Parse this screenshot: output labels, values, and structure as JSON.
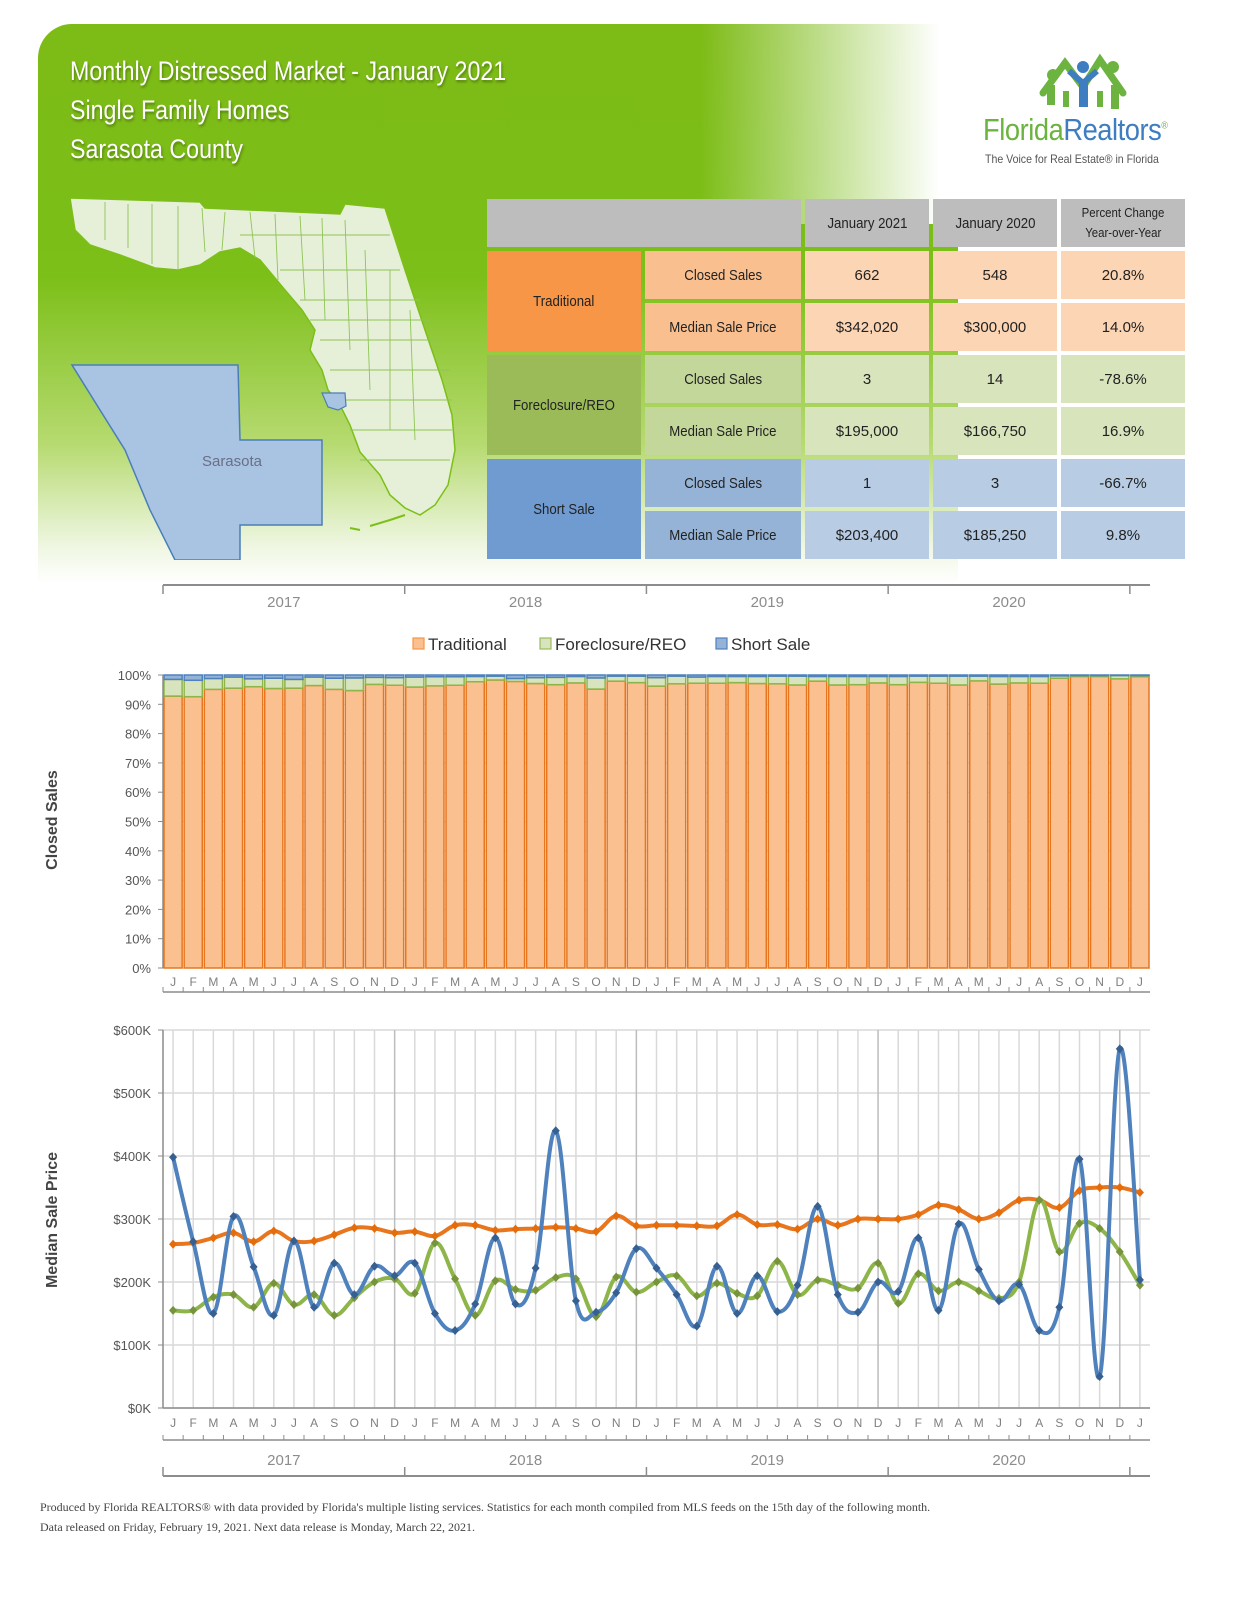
{
  "header": {
    "title_line1": "Monthly Distressed Market - January 2021",
    "title_line2": "Single Family Homes",
    "title_line3": "Sarasota County"
  },
  "logo": {
    "name_part1": "Florida",
    "name_part2": "Realtors",
    "registered": "®",
    "tagline": "The Voice for Real Estate® in Florida"
  },
  "map": {
    "county_label": "Sarasota",
    "colors": {
      "state": "#e6f0d8",
      "county": "#a9c4e2",
      "border_green": "#7cbf18",
      "border_blue": "#4a7eb8"
    }
  },
  "stats_table": {
    "columns": [
      "January 2021",
      "January 2020",
      "Percent Change Year-over-Year"
    ],
    "col3_line1": "Percent Change",
    "col3_line2": "Year-over-Year",
    "groups": [
      {
        "category": "Traditional",
        "rows": [
          {
            "metric": "Closed Sales",
            "current": "662",
            "prior": "548",
            "change": "20.8%"
          },
          {
            "metric": "Median Sale Price",
            "current": "$342,020",
            "prior": "$300,000",
            "change": "14.0%"
          }
        ]
      },
      {
        "category": "Foreclosure/REO",
        "rows": [
          {
            "metric": "Closed Sales",
            "current": "3",
            "prior": "14",
            "change": "-78.6%"
          },
          {
            "metric": "Median Sale Price",
            "current": "$195,000",
            "prior": "$166,750",
            "change": "16.9%"
          }
        ]
      },
      {
        "category": "Short Sale",
        "rows": [
          {
            "metric": "Closed Sales",
            "current": "1",
            "prior": "3",
            "change": "-66.7%"
          },
          {
            "metric": "Median Sale Price",
            "current": "$203,400",
            "prior": "$185,250",
            "change": "9.8%"
          }
        ]
      }
    ]
  },
  "colors": {
    "traditional": "#f79646",
    "traditional_fill": "#fac090",
    "traditional_line": "#e8761f",
    "foreclosure": "#9bbb59",
    "foreclosure_fill": "#d7e4bd",
    "foreclosure_line": "#8db54a",
    "short_sale": "#4f81bd",
    "short_sale_fill": "#95b3d7"
  },
  "chart_data": [
    {
      "type": "bar",
      "stacked": "percent",
      "ylabel": "Closed Sales",
      "ylim": [
        0,
        100
      ],
      "yticks": [
        "0%",
        "10%",
        "20%",
        "30%",
        "40%",
        "50%",
        "60%",
        "70%",
        "80%",
        "90%",
        "100%"
      ],
      "grid": true,
      "legend": {
        "placement": "top-center",
        "entries": [
          "Traditional",
          "Foreclosure/REO",
          "Short Sale"
        ]
      },
      "month_labels": [
        "J",
        "F",
        "M",
        "A",
        "M",
        "J",
        "J",
        "A",
        "S",
        "O",
        "N",
        "D",
        "J",
        "F",
        "M",
        "A",
        "M",
        "J",
        "J",
        "A",
        "S",
        "O",
        "N",
        "D",
        "J",
        "F",
        "M",
        "A",
        "M",
        "J",
        "J",
        "A",
        "S",
        "O",
        "N",
        "D",
        "J",
        "F",
        "M",
        "A",
        "M",
        "J",
        "J",
        "A",
        "S",
        "O",
        "N",
        "D",
        "J"
      ],
      "year_labels": [
        "2017",
        "2018",
        "2019",
        "2020"
      ],
      "series": [
        {
          "name": "Traditional",
          "values": [
            92.8,
            92.6,
            95.1,
            95.5,
            96.0,
            95.4,
            95.5,
            96.4,
            95.1,
            94.7,
            96.8,
            96.5,
            95.9,
            96.3,
            96.5,
            97.7,
            98.3,
            97.8,
            97.1,
            96.7,
            97.3,
            95.2,
            97.9,
            97.4,
            96.2,
            97.0,
            97.2,
            97.2,
            97.4,
            97.1,
            97.0,
            96.6,
            97.9,
            96.6,
            96.7,
            97.3,
            96.7,
            97.5,
            97.2,
            96.6,
            98.0,
            96.9,
            97.3,
            97.2,
            98.9,
            99.5,
            99.5,
            98.7,
            99.4
          ]
        },
        {
          "name": "Foreclosure/REO",
          "values": [
            5.7,
            5.6,
            3.7,
            3.8,
            2.7,
            3.5,
            3.0,
            2.9,
            3.8,
            4.3,
            2.4,
            2.6,
            3.4,
            3.1,
            2.9,
            1.8,
            1.3,
            1.0,
            2.0,
            2.5,
            2.2,
            3.8,
            1.7,
            2.2,
            2.9,
            2.6,
            2.1,
            2.3,
            2.1,
            2.4,
            2.6,
            3.0,
            1.6,
            2.9,
            2.8,
            2.2,
            2.8,
            2.1,
            2.4,
            3.0,
            1.6,
            2.6,
            2.2,
            2.3,
            0.8,
            0.3,
            0.3,
            1.1,
            0.4
          ]
        },
        {
          "name": "Short Sale",
          "values": [
            1.5,
            1.8,
            1.2,
            0.7,
            1.3,
            1.1,
            1.5,
            0.7,
            1.1,
            1.0,
            0.8,
            0.9,
            0.7,
            0.6,
            0.6,
            0.5,
            0.4,
            1.2,
            0.9,
            0.8,
            0.5,
            1.0,
            0.4,
            0.4,
            0.9,
            0.4,
            0.7,
            0.5,
            0.5,
            0.5,
            0.4,
            0.4,
            0.5,
            0.5,
            0.5,
            0.5,
            0.5,
            0.4,
            0.4,
            0.4,
            0.4,
            0.5,
            0.5,
            0.5,
            0.3,
            0.2,
            0.2,
            0.2,
            0.2
          ]
        }
      ]
    },
    {
      "type": "line",
      "ylabel": "Median Sale Price",
      "ylim": [
        0,
        600000
      ],
      "yticks": [
        "$0K",
        "$100K",
        "$200K",
        "$300K",
        "$400K",
        "$500K",
        "$600K"
      ],
      "grid": true,
      "month_labels": [
        "J",
        "F",
        "M",
        "A",
        "M",
        "J",
        "J",
        "A",
        "S",
        "O",
        "N",
        "D",
        "J",
        "F",
        "M",
        "A",
        "M",
        "J",
        "J",
        "A",
        "S",
        "O",
        "N",
        "D",
        "J",
        "F",
        "M",
        "A",
        "M",
        "J",
        "J",
        "A",
        "S",
        "O",
        "N",
        "D",
        "J",
        "F",
        "M",
        "A",
        "M",
        "J",
        "J",
        "A",
        "S",
        "O",
        "N",
        "D",
        "J"
      ],
      "year_labels": [
        "2017",
        "2018",
        "2019",
        "2020"
      ],
      "series": [
        {
          "name": "Traditional",
          "values": [
            260000,
            262000,
            270000,
            278000,
            264000,
            281000,
            265000,
            265000,
            275000,
            286000,
            285000,
            278000,
            280000,
            273000,
            290000,
            290000,
            282000,
            284000,
            285000,
            287000,
            285000,
            280000,
            305000,
            289000,
            290000,
            290000,
            289000,
            289000,
            307000,
            291000,
            291000,
            284000,
            300000,
            290000,
            300000,
            300000,
            300000,
            307000,
            322000,
            315000,
            300000,
            310000,
            330000,
            330000,
            318000,
            345000,
            350000,
            350000,
            342020
          ]
        },
        {
          "name": "Foreclosure/REO",
          "values": [
            155000,
            155000,
            176000,
            180000,
            160000,
            198000,
            164000,
            180000,
            147000,
            175000,
            200000,
            205000,
            182000,
            262000,
            205000,
            147000,
            202000,
            188000,
            187000,
            207000,
            205000,
            145000,
            208000,
            184000,
            200000,
            210000,
            178000,
            198000,
            182000,
            178000,
            233000,
            180000,
            203000,
            195000,
            190000,
            230000,
            166000,
            213000,
            186000,
            200000,
            186000,
            174000,
            200000,
            330000,
            248000,
            293000,
            285000,
            248000,
            195000
          ]
        },
        {
          "name": "Short Sale",
          "values": [
            398000,
            264000,
            150000,
            304000,
            224000,
            147000,
            265000,
            160000,
            230000,
            180000,
            225000,
            210000,
            230000,
            150000,
            123000,
            165000,
            270000,
            165000,
            222000,
            440000,
            170000,
            152000,
            183000,
            253000,
            222000,
            180000,
            130000,
            225000,
            150000,
            210000,
            153000,
            195000,
            320000,
            180000,
            152000,
            200000,
            185000,
            270000,
            155000,
            292000,
            220000,
            170000,
            196000,
            123000,
            160000,
            395000,
            50000,
            570000,
            203400
          ]
        }
      ]
    }
  ],
  "footer": {
    "line1": "Produced by Florida REALTORS® with data provided by Florida's multiple listing services. Statistics for each month compiled from MLS feeds on the 15th day of the following month.",
    "line2": "Data released on Friday, February 19, 2021. Next data release is Monday, March 22, 2021."
  }
}
